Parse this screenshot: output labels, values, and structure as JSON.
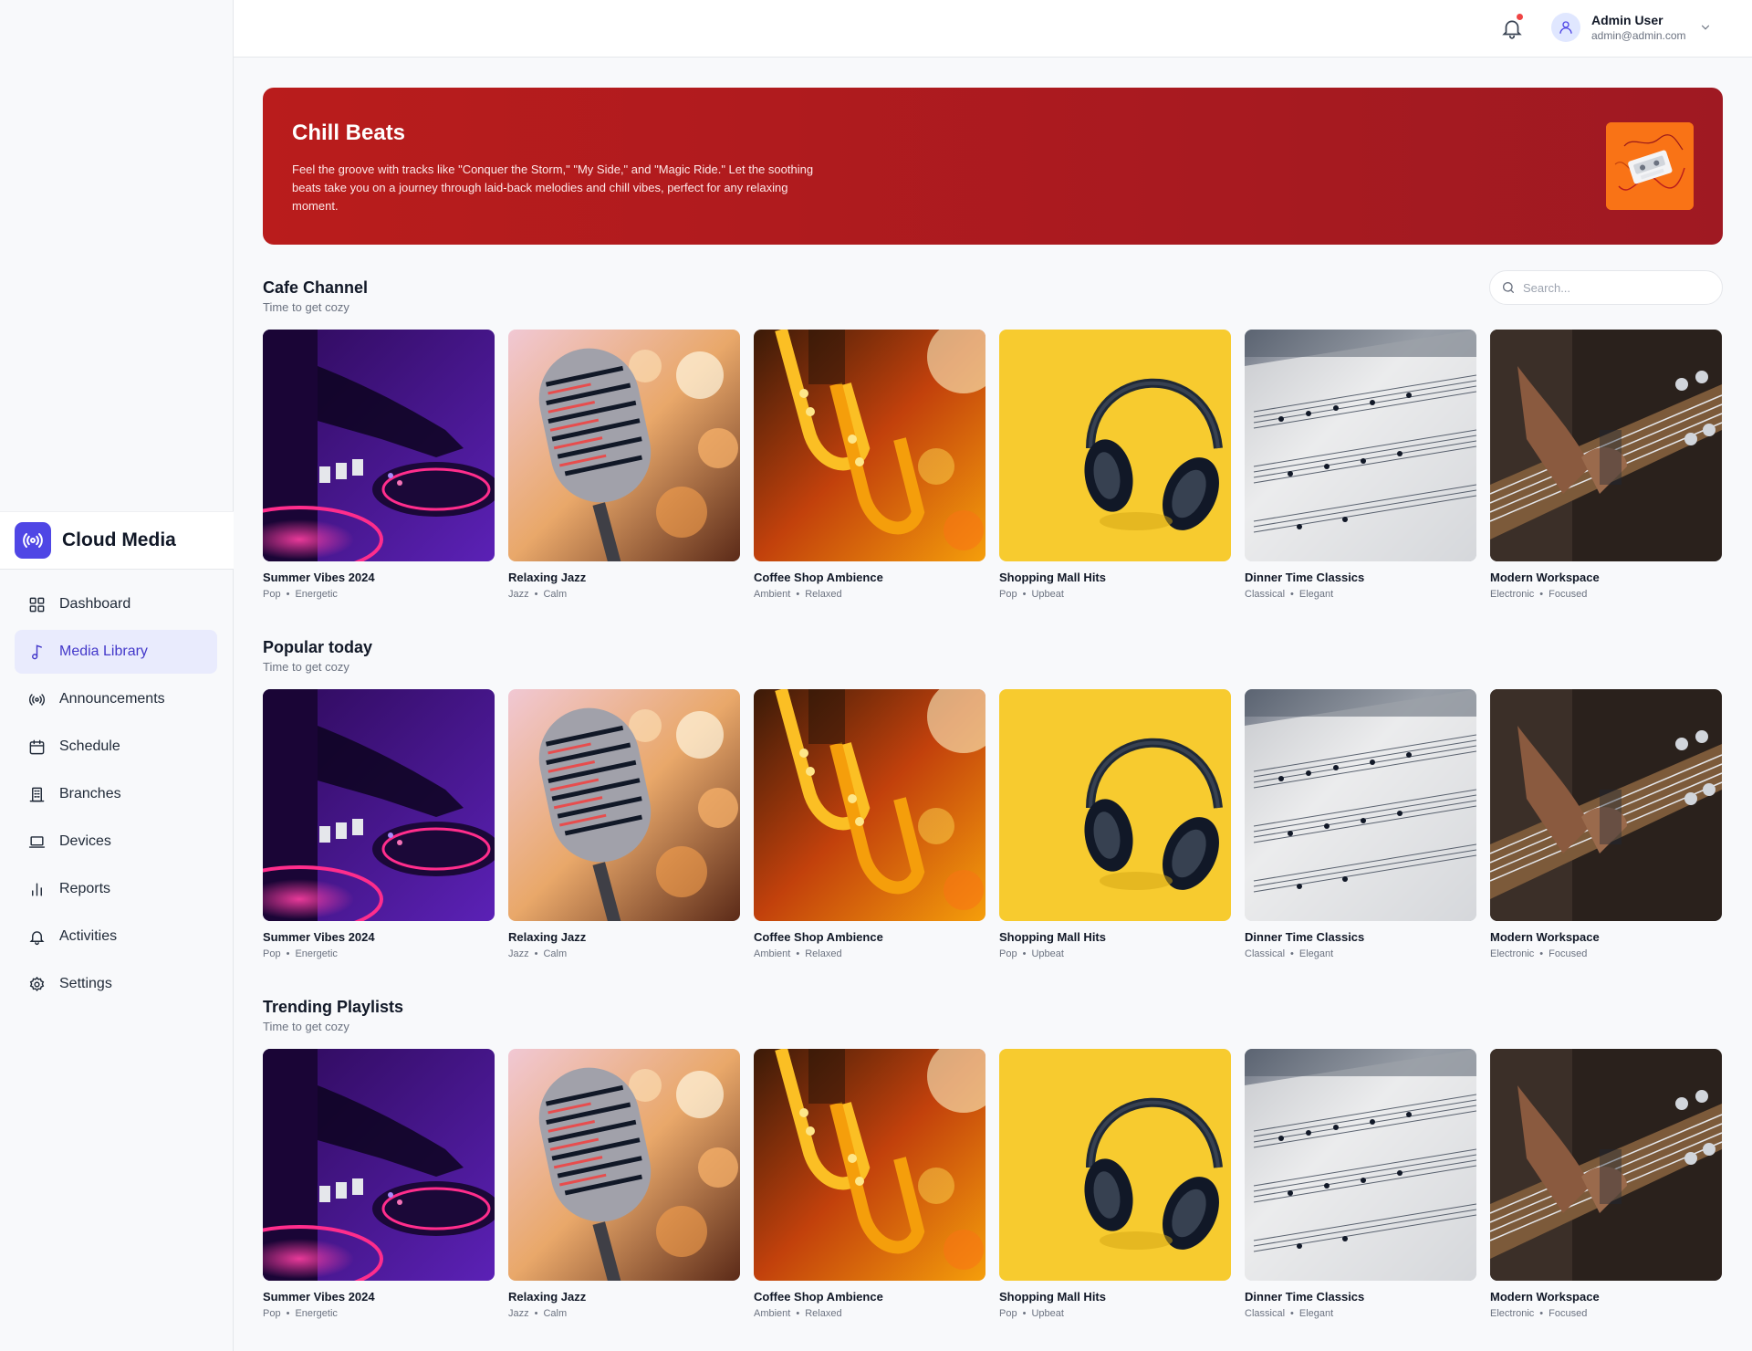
{
  "brand": {
    "name": "Cloud Media",
    "icon": "broadcast-icon",
    "accent": "#4f46e5"
  },
  "nav": [
    {
      "label": "Dashboard",
      "icon": "grid-icon",
      "active": false
    },
    {
      "label": "Media Library",
      "icon": "music-note-icon",
      "active": true
    },
    {
      "label": "Announcements",
      "icon": "broadcast-icon",
      "active": false
    },
    {
      "label": "Schedule",
      "icon": "calendar-icon",
      "active": false
    },
    {
      "label": "Branches",
      "icon": "building-icon",
      "active": false
    },
    {
      "label": "Devices",
      "icon": "laptop-icon",
      "active": false
    },
    {
      "label": "Reports",
      "icon": "bar-chart-icon",
      "active": false
    },
    {
      "label": "Activities",
      "icon": "bell-icon",
      "active": false
    },
    {
      "label": "Settings",
      "icon": "gear-icon",
      "active": false
    }
  ],
  "header": {
    "notifications_icon": "bell-icon",
    "user": {
      "name": "Admin User",
      "email": "admin@admin.com"
    }
  },
  "hero": {
    "title": "Chill Beats",
    "description": "Feel the groove with tracks like \"Conquer the Storm,\" \"My Side,\" and \"Magic Ride.\" Let the soothing beats take you on a journey through laid-back melodies and chill vibes, perfect for any relaxing moment.",
    "background": "#b91c1c"
  },
  "search": {
    "placeholder": "Search..."
  },
  "sections": [
    {
      "title": "Cafe Channel",
      "subtitle": "Time to get cozy",
      "cards": [
        {
          "title": "Summer Vibes 2024",
          "genre": "Pop",
          "mood": "Energetic"
        },
        {
          "title": "Relaxing Jazz",
          "genre": "Jazz",
          "mood": "Calm"
        },
        {
          "title": "Coffee Shop Ambience",
          "genre": "Ambient",
          "mood": "Relaxed"
        },
        {
          "title": "Shopping Mall Hits",
          "genre": "Pop",
          "mood": "Upbeat"
        },
        {
          "title": "Dinner Time Classics",
          "genre": "Classical",
          "mood": "Elegant"
        },
        {
          "title": "Modern Workspace",
          "genre": "Electronic",
          "mood": "Focused"
        }
      ]
    },
    {
      "title": "Popular today",
      "subtitle": "Time to get cozy",
      "cards": [
        {
          "title": "Summer Vibes 2024",
          "genre": "Pop",
          "mood": "Energetic"
        },
        {
          "title": "Relaxing Jazz",
          "genre": "Jazz",
          "mood": "Calm"
        },
        {
          "title": "Coffee Shop Ambience",
          "genre": "Ambient",
          "mood": "Relaxed"
        },
        {
          "title": "Shopping Mall Hits",
          "genre": "Pop",
          "mood": "Upbeat"
        },
        {
          "title": "Dinner Time Classics",
          "genre": "Classical",
          "mood": "Elegant"
        },
        {
          "title": "Modern Workspace",
          "genre": "Electronic",
          "mood": "Focused"
        }
      ]
    },
    {
      "title": "Trending Playlists",
      "subtitle": "Time to get cozy",
      "cards": [
        {
          "title": "Summer Vibes 2024",
          "genre": "Pop",
          "mood": "Energetic"
        },
        {
          "title": "Relaxing Jazz",
          "genre": "Jazz",
          "mood": "Calm"
        },
        {
          "title": "Coffee Shop Ambience",
          "genre": "Ambient",
          "mood": "Relaxed"
        },
        {
          "title": "Shopping Mall Hits",
          "genre": "Pop",
          "mood": "Upbeat"
        },
        {
          "title": "Dinner Time Classics",
          "genre": "Classical",
          "mood": "Elegant"
        },
        {
          "title": "Modern Workspace",
          "genre": "Electronic",
          "mood": "Focused"
        }
      ]
    }
  ]
}
